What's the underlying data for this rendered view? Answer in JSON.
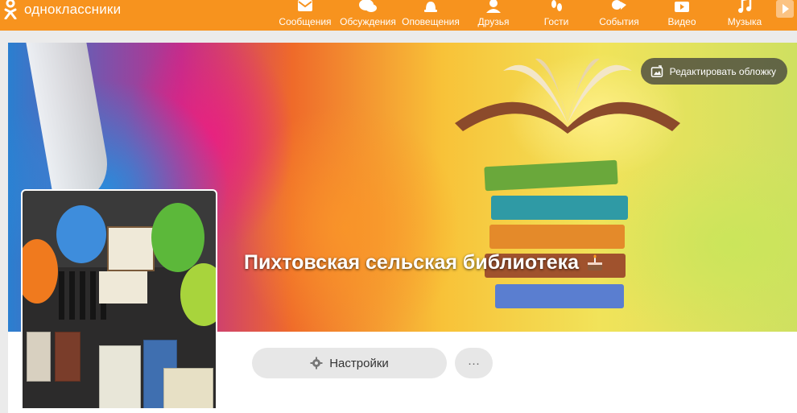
{
  "brand": {
    "name": "одноклассники",
    "color": "#f7931e"
  },
  "nav": {
    "items": [
      {
        "label": "Сообщения",
        "icon": "envelope-icon"
      },
      {
        "label": "Обсуждения",
        "icon": "chat-bubbles-icon"
      },
      {
        "label": "Оповещения",
        "icon": "bell-icon"
      },
      {
        "label": "Друзья",
        "icon": "friends-icon"
      },
      {
        "label": "Гости",
        "icon": "footprints-icon"
      },
      {
        "label": "События",
        "icon": "events-icon"
      },
      {
        "label": "Видео",
        "icon": "video-icon"
      },
      {
        "label": "Музыка",
        "icon": "music-note-icon"
      }
    ]
  },
  "cover": {
    "edit_label": "Редактировать обложку"
  },
  "group": {
    "title": "Пихтовская сельская библиотека"
  },
  "actions": {
    "settings_label": "Настройки",
    "more_label": "···"
  }
}
